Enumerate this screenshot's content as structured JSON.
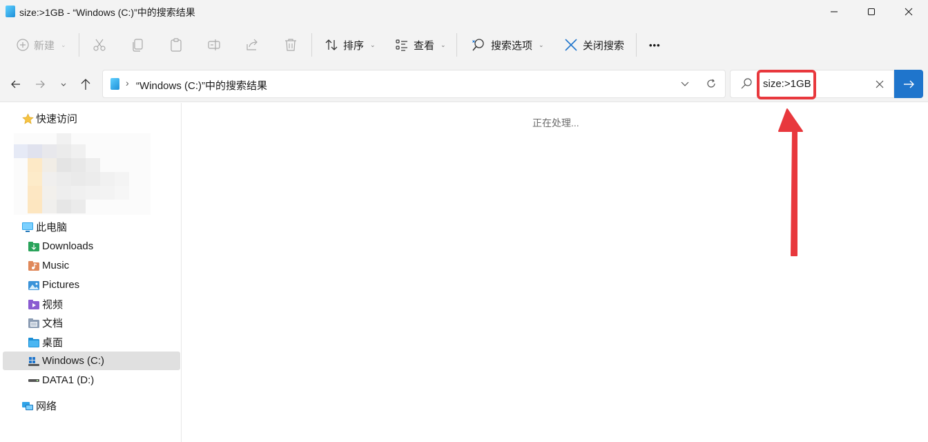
{
  "window": {
    "title": "size:>1GB - “Windows (C:)”中的搜索结果"
  },
  "toolbar": {
    "new_label": "新建",
    "sort_label": "排序",
    "view_label": "查看",
    "search_options_label": "搜索选项",
    "close_search_label": "关闭搜索",
    "more_label": "•••"
  },
  "address": {
    "path": "“Windows (C:)”中的搜索结果"
  },
  "search": {
    "query": "size:>1GB"
  },
  "sidebar": {
    "quick_access": "快速访问",
    "this_pc": "此电脑",
    "items": [
      {
        "label": "Downloads"
      },
      {
        "label": "Music"
      },
      {
        "label": "Pictures"
      },
      {
        "label": "视频"
      },
      {
        "label": "文档"
      },
      {
        "label": "桌面"
      },
      {
        "label": "Windows (C:)"
      },
      {
        "label": "DATA1 (D:)"
      }
    ],
    "network": "网络"
  },
  "content": {
    "status": "正在处理..."
  },
  "colors": {
    "accent": "#1f75cc",
    "annotation": "#e8383d",
    "chrome_bg": "#f3f3f3",
    "selected_bg": "#e0e0e0"
  }
}
